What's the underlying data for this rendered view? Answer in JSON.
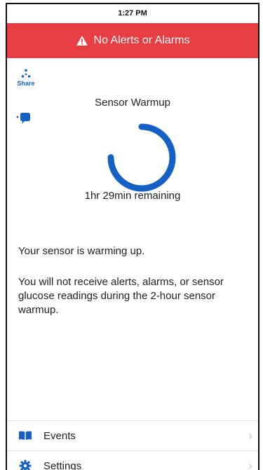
{
  "status_bar": {
    "time": "1:27 PM"
  },
  "alert_banner": {
    "text": "No Alerts or Alarms",
    "color": "#e83d43"
  },
  "share": {
    "label": "Share"
  },
  "warmup": {
    "title": "Sensor Warmup",
    "remaining": "1hr 29min remaining",
    "progress": 0.75,
    "accent": "#1560c4"
  },
  "messages": {
    "line1": "Your sensor is warming up.",
    "line2": "You will not receive alerts, alarms, or sensor glucose readings during the 2-hour sensor warmup."
  },
  "menu": [
    {
      "label": "Events",
      "icon": "book-icon"
    },
    {
      "label": "Settings",
      "icon": "gear-icon"
    }
  ]
}
